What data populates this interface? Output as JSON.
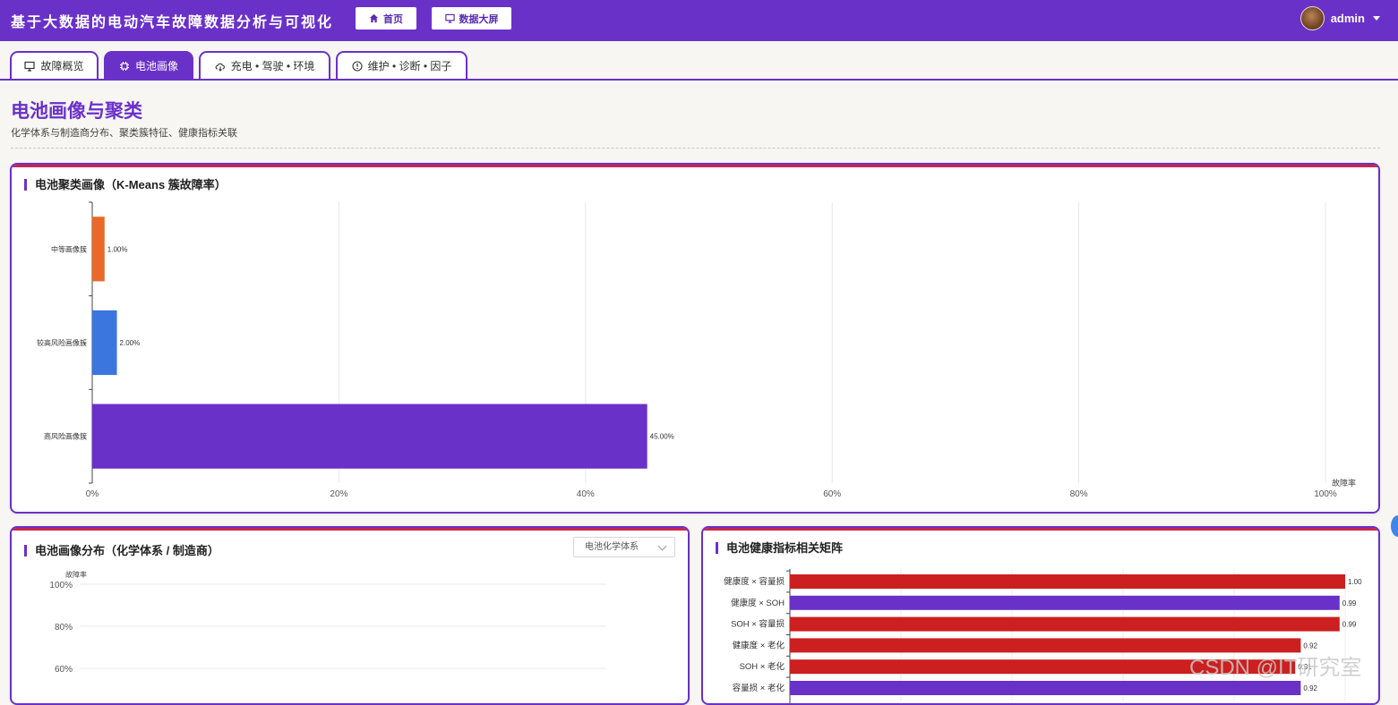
{
  "header": {
    "app_title": "基于大数据的电动汽车故障数据分析与可视化",
    "home_label": "首页",
    "dashboard_label": "数据大屏",
    "username": "admin"
  },
  "tabs": [
    {
      "label": "故障概览",
      "active": false,
      "icon": "monitor-icon"
    },
    {
      "label": "电池画像",
      "active": true,
      "icon": "chip-icon"
    },
    {
      "label": "充电 • 驾驶 • 环境",
      "active": false,
      "icon": "cloud-icon"
    },
    {
      "label": "维护 • 诊断 • 因子",
      "active": false,
      "icon": "alert-circle-icon"
    }
  ],
  "page": {
    "title": "电池画像与聚类",
    "subtitle": "化学体系与制造商分布、聚类簇特征、健康指标关联"
  },
  "colors": {
    "accent": "#6a31c9",
    "red": "#cc1f1f",
    "orange": "#e8692a",
    "blue": "#3a76dd"
  },
  "cluster_card": {
    "title": "电池聚类画像（K-Means 簇故障率）"
  },
  "distribution_card": {
    "title": "电池画像分布（化学体系 / 制造商）",
    "select_value": "电池化学体系"
  },
  "correlation_card": {
    "title": "电池健康指标相关矩阵"
  },
  "watermark": "CSDN @IT研究室",
  "chart_data": [
    {
      "type": "bar",
      "orientation": "horizontal",
      "title": "电池聚类画像（K-Means 簇故障率）",
      "xlabel": "故障率",
      "xlim": [
        0,
        100
      ],
      "xticks": [
        "0%",
        "20%",
        "40%",
        "60%",
        "80%",
        "100%"
      ],
      "grid": true,
      "categories": [
        "中等画像簇",
        "较高风险画像簇",
        "高风险画像簇"
      ],
      "values": [
        1.0,
        2.0,
        45.0
      ],
      "value_labels": [
        "1.00%",
        "2.00%",
        "45.00%"
      ],
      "colors": [
        "#e8692a",
        "#3a76dd",
        "#6a31c9"
      ]
    },
    {
      "type": "bar",
      "title": "电池画像分布（化学体系 / 制造商）",
      "ylabel": "故障率",
      "ylim": [
        0,
        100
      ],
      "yticks_visible": [
        "100%",
        "80%",
        "60%"
      ],
      "grid": true,
      "categories": [],
      "values": []
    },
    {
      "type": "bar",
      "orientation": "horizontal",
      "title": "电池健康指标相关矩阵",
      "xlim": [
        0,
        1
      ],
      "grid": true,
      "categories": [
        "健康度 × 容量损",
        "健康度 × SOH",
        "SOH × 容量损",
        "健康度 × 老化",
        "SOH × 老化",
        "容量损 × 老化"
      ],
      "values": [
        1.0,
        0.99,
        0.99,
        0.92,
        0.91,
        0.92
      ],
      "value_labels": [
        "1.00",
        "0.99",
        "0.99",
        "0.92",
        "0.91",
        "0.92"
      ],
      "colors": [
        "#cc1f1f",
        "#6a31c9",
        "#cc1f1f",
        "#cc1f1f",
        "#cc1f1f",
        "#6a31c9"
      ]
    }
  ]
}
